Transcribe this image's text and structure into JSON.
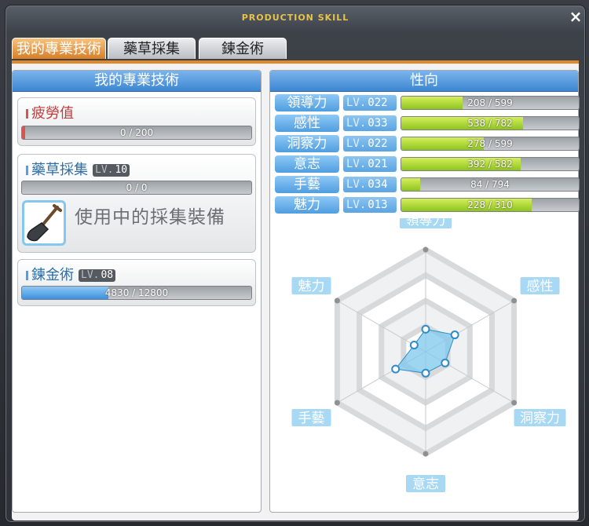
{
  "window": {
    "title": "PRODUCTION SKILL",
    "close_label": "×"
  },
  "tabs": [
    {
      "label": "我的專業技術",
      "active": true
    },
    {
      "label": "藥草採集",
      "active": false
    },
    {
      "label": "鍊金術",
      "active": false
    }
  ],
  "left_panel": {
    "header": "我的專業技術",
    "fatigue": {
      "title": "疲勞值",
      "value": 0,
      "max": 200,
      "text": "0 / 200"
    },
    "herb": {
      "title": "藥草採集",
      "lv_prefix": "LV.",
      "lv": "10",
      "text": "0 / 0",
      "progress": 0,
      "equip_label": "使用中的採集裝備",
      "equip_icon": "shovel-icon"
    },
    "alchemy": {
      "title": "鍊金術",
      "lv_prefix": "LV.",
      "lv": "08",
      "text": "4830 / 12800",
      "value": 4830,
      "max": 12800
    }
  },
  "right_panel": {
    "header": "性向",
    "stats": [
      {
        "name": "領導力",
        "lv_prefix": "LV.",
        "lv": "022",
        "value": 208,
        "max": 599,
        "text": "208 / 599"
      },
      {
        "name": "感性",
        "lv_prefix": "LV.",
        "lv": "033",
        "value": 538,
        "max": 782,
        "text": "538 / 782"
      },
      {
        "name": "洞察力",
        "lv_prefix": "LV.",
        "lv": "022",
        "value": 278,
        "max": 599,
        "text": "278 / 599"
      },
      {
        "name": "意志",
        "lv_prefix": "LV.",
        "lv": "021",
        "value": 392,
        "max": 582,
        "text": "392 / 582"
      },
      {
        "name": "手藝",
        "lv_prefix": "LV.",
        "lv": "034",
        "value": 84,
        "max": 794,
        "text": "84 / 794"
      },
      {
        "name": "魅力",
        "lv_prefix": "LV.",
        "lv": "013",
        "value": 228,
        "max": 310,
        "text": "228 / 310"
      }
    ]
  },
  "chart_data": {
    "type": "radar",
    "axes": [
      "領導力",
      "感性",
      "洞察力",
      "意志",
      "手藝",
      "魅力"
    ],
    "values": [
      0.22,
      0.33,
      0.22,
      0.21,
      0.34,
      0.13
    ],
    "grid_levels": 4,
    "colors": {
      "fill": "#7ec8ee",
      "stroke": "#2f8cc8",
      "grid": "#d8d9db"
    }
  },
  "colors": {
    "accent": "#e0882c",
    "header_blue": "#3d86d2",
    "stat_green": "#a5d430",
    "fatigue_red": "#d9534f",
    "exp_blue": "#4fa0ea"
  }
}
